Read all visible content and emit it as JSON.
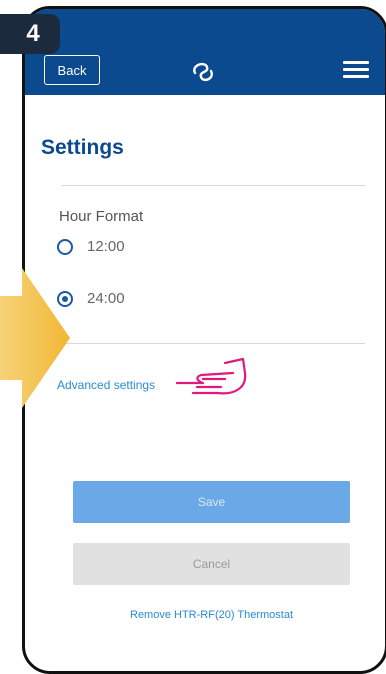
{
  "step": {
    "number": "4"
  },
  "header": {
    "back_label": "Back",
    "colors": {
      "bar": "#0b4a8f"
    }
  },
  "page": {
    "title": "Settings"
  },
  "hour_format": {
    "label": "Hour Format",
    "options": [
      {
        "label": "12:00",
        "selected": false
      },
      {
        "label": "24:00",
        "selected": true
      }
    ]
  },
  "advanced": {
    "label": "Advanced settings"
  },
  "actions": {
    "save_label": "Save",
    "cancel_label": "Cancel",
    "remove_label": "Remove HTR-RF(20) Thermostat"
  },
  "icons": {
    "logo": "logo-icon",
    "menu": "hamburger-menu-icon",
    "pointer": "pointing-hand-icon",
    "arrow": "arrow-right-icon"
  },
  "colors": {
    "accent": "#2a8ad4",
    "save": "#6aa8e8",
    "pointer": "#e0197d",
    "arrow": "#f6c244"
  }
}
